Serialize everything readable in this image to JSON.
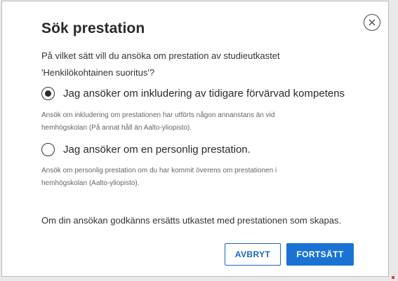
{
  "dialog": {
    "title": "Sök prestation",
    "close_icon": "close-circle-icon",
    "question_line1": "På vilket sätt vill du ansöka om prestation av studieutkastet",
    "question_line2": "'Henkilökohtainen suoritus'?",
    "options": [
      {
        "label": "Jag ansöker om inkludering av tidigare förvärvad kompetens",
        "selected": true,
        "help_line1": "Ansök om inkludering om prestationen har utförts någon annanstans än vid",
        "help_line2": "hemhögskolan (På annat håll än Aalto-yliopisto)."
      },
      {
        "label": "Jag ansöker om en personlig prestation.",
        "selected": false,
        "help_line1": "Ansök om personlig prestation om du har kommit överens om prestationen i",
        "help_line2": "hemhögskolan (Aalto-yliopisto)."
      }
    ],
    "note": "Om din ansökan godkänns ersätts utkastet med prestationen som skapas.",
    "cancel_label": "AVBRYT",
    "continue_label": "FORTSÄTT"
  },
  "colors": {
    "primary": "#1a73d4",
    "text": "#2a2a2a",
    "muted": "#666666"
  }
}
